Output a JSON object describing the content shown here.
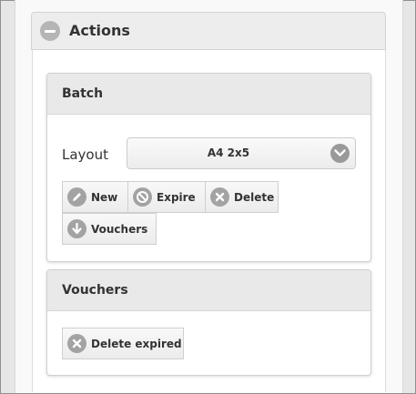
{
  "actions_panel": {
    "title": "Actions",
    "collapse_icon": "minus-circle-icon"
  },
  "batch": {
    "title": "Batch",
    "layout_label": "Layout",
    "layout_select": {
      "value": "A4 2x5",
      "icon": "chevron-down-icon"
    },
    "buttons": [
      {
        "label": "New",
        "icon": "pencil-icon"
      },
      {
        "label": "Expire",
        "icon": "forbidden-icon"
      },
      {
        "label": "Delete",
        "icon": "delete-icon"
      },
      {
        "label": "Vouchers",
        "icon": "arrow-down-icon"
      }
    ]
  },
  "vouchers": {
    "title": "Vouchers",
    "buttons": [
      {
        "label": "Delete expired",
        "icon": "delete-icon"
      }
    ]
  }
}
